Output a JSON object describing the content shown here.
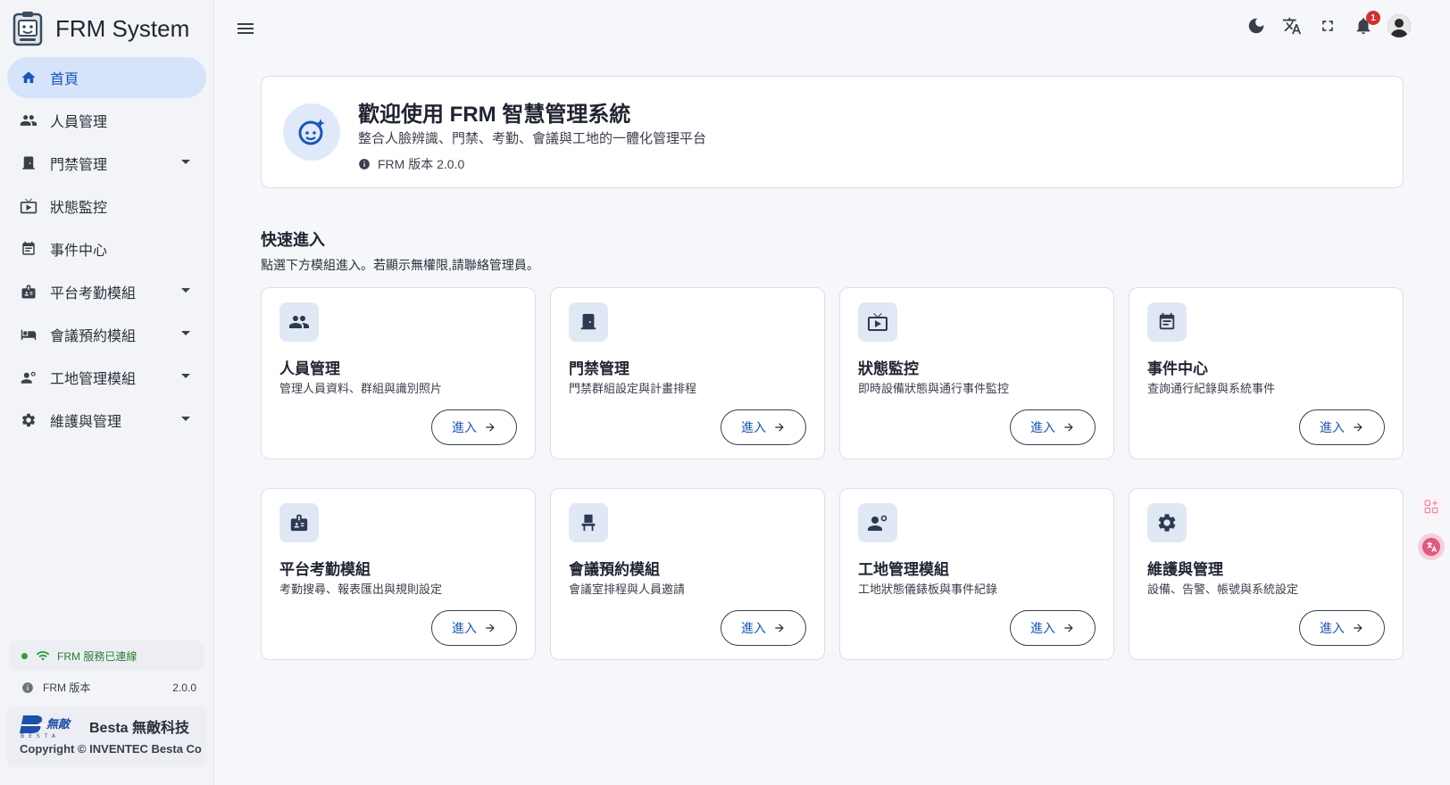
{
  "app": {
    "title": "FRM System"
  },
  "sidebar": {
    "items": [
      {
        "label": "首頁",
        "icon": "home-icon",
        "active": true,
        "expandable": false
      },
      {
        "label": "人員管理",
        "icon": "people-icon",
        "active": false,
        "expandable": false
      },
      {
        "label": "門禁管理",
        "icon": "door-icon",
        "active": false,
        "expandable": true
      },
      {
        "label": "狀態監控",
        "icon": "monitor-icon",
        "active": false,
        "expandable": false
      },
      {
        "label": "事件中心",
        "icon": "event-icon",
        "active": false,
        "expandable": false
      },
      {
        "label": "平台考勤模組",
        "icon": "badge-icon",
        "active": false,
        "expandable": true
      },
      {
        "label": "會議預約模組",
        "icon": "chair-icon",
        "active": false,
        "expandable": true
      },
      {
        "label": "工地管理模組",
        "icon": "worker-icon",
        "active": false,
        "expandable": true
      },
      {
        "label": "維護與管理",
        "icon": "gear-icon",
        "active": false,
        "expandable": true
      }
    ],
    "status_text": "FRM 服務已連線",
    "version_label": "FRM 版本",
    "version_value": "2.0.0",
    "company_name": "Besta 無敵科技",
    "copyright": "Copyright © INVENTEC Besta Co"
  },
  "topbar": {
    "notification_count": "1"
  },
  "welcome": {
    "title": "歡迎使用 FRM 智慧管理系統",
    "subtitle": "整合人臉辨識、門禁、考勤、會議與工地的一體化管理平台",
    "version": "FRM 版本 2.0.0"
  },
  "quick": {
    "title": "快速進入",
    "subtitle": "點選下方模組進入。若顯示無權限,請聯絡管理員。",
    "enter_label": "進入",
    "cards": [
      {
        "title": "人員管理",
        "desc": "管理人員資料、群組與識別照片",
        "icon": "people-icon"
      },
      {
        "title": "門禁管理",
        "desc": "門禁群組設定與計畫排程",
        "icon": "door-icon"
      },
      {
        "title": "狀態監控",
        "desc": "即時設備狀態與通行事件監控",
        "icon": "monitor-icon"
      },
      {
        "title": "事件中心",
        "desc": "查詢通行紀錄與系統事件",
        "icon": "event-icon"
      },
      {
        "title": "平台考勤模組",
        "desc": "考勤搜尋、報表匯出與規則設定",
        "icon": "badge-icon"
      },
      {
        "title": "會議預約模組",
        "desc": "會議室排程與人員邀請",
        "icon": "chair-icon"
      },
      {
        "title": "工地管理模組",
        "desc": "工地狀態儀錶板與事件紀錄",
        "icon": "worker-icon"
      },
      {
        "title": "維護與管理",
        "desc": "設備、告警、帳號與系統設定",
        "icon": "gear-icon"
      }
    ]
  },
  "colors": {
    "accent": "#1a56b8",
    "active_bg": "#d6e4fb",
    "status_green": "#2e9e3a",
    "badge_red": "#d32f2f"
  }
}
